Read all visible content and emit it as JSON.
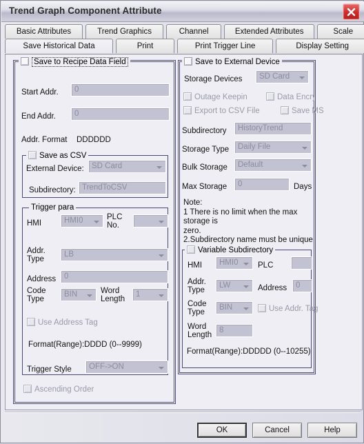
{
  "window": {
    "title": "Trend Graph Component Attribute",
    "close_icon": "close-icon"
  },
  "tabs": {
    "row1": [
      {
        "label": "Basic Attributes",
        "active": false
      },
      {
        "label": "Trend Graphics",
        "active": false
      },
      {
        "label": "Channel",
        "active": false
      },
      {
        "label": "Extended Attributes",
        "active": false
      },
      {
        "label": "Scale",
        "active": false
      }
    ],
    "row2": [
      {
        "label": "Save Historical Data",
        "active": true
      },
      {
        "label": "Print",
        "active": false
      },
      {
        "label": "Print Trigger Line",
        "active": false
      },
      {
        "label": "Display Setting",
        "active": false
      }
    ]
  },
  "left": {
    "group_title": "Save to Recipe Data Field",
    "start_addr_label": "Start Addr.",
    "start_addr_value": "0",
    "end_addr_label": "End Addr.",
    "end_addr_value": "0",
    "addr_format_label": "Addr. Format",
    "addr_format_value": "DDDDDD",
    "csv_group_title": "Save as CSV",
    "external_device_label": "External Device:",
    "external_device_value": "SD Card",
    "subdirectory_label": "Subdirectory:",
    "subdirectory_value": "TrendToCSV",
    "trigger_group_title": "Trigger para",
    "hmi_label": "HMI",
    "hmi_value": "HMI0",
    "plc_no_label": "PLC\nNo.",
    "plc_no_value": "",
    "addr_type_label": "Addr.\nType",
    "addr_type_value": "LB",
    "address_label": "Address",
    "address_value": "0",
    "code_type_label": "Code\nType",
    "code_type_value": "BIN",
    "word_length_label": "Word\nLength",
    "word_length_value": "1",
    "use_address_tag_label": "Use Address Tag",
    "format_range": "Format(Range):DDDD (0--9999)",
    "trigger_style_label": "Trigger Style",
    "trigger_style_value": "OFF->ON",
    "ascending_order_label": "Ascending Order"
  },
  "right": {
    "group_title": "Save to External Device",
    "storage_devices_label": "Storage Devices",
    "storage_devices_value": "SD Card",
    "outage_keepin_label": "Outage Keepin",
    "data_encryption_label": "Data Encryptio",
    "export_csv_label": "Export to CSV File",
    "save_ms_label": "Save MS",
    "subdirectory_label": "Subdirectory",
    "subdirectory_value": "HistoryTrend",
    "storage_type_label": "Storage Type",
    "storage_type_value": "Daily File",
    "bulk_storage_label": "Bulk Storage",
    "bulk_storage_value": "Default",
    "max_storage_label": "Max Storage",
    "max_storage_value": "0",
    "days_label": "Days",
    "note_text": "Note:\n1 There is no limit when the max storage is\nzero.\n2.Subdirectory name must be unique",
    "var_subdir_group_title": "Variable Subdirectory",
    "hmi_label": "HMI",
    "hmi_value": "HMI0",
    "plc_label": "PLC",
    "plc_value": "",
    "addr_type_label": "Addr.\nType",
    "addr_type_value": "LW",
    "address_label": "Address",
    "address_value": "0",
    "code_type_label": "Code\nType",
    "code_type_value": "BIN",
    "use_addr_tag_label": "Use Addr. Tag",
    "word_length_label": "Word\nLength",
    "word_length_value": "8",
    "format_range": "Format(Range):DDDDD (0--10255)"
  },
  "buttons": {
    "ok": "OK",
    "cancel": "Cancel",
    "help": "Help"
  }
}
